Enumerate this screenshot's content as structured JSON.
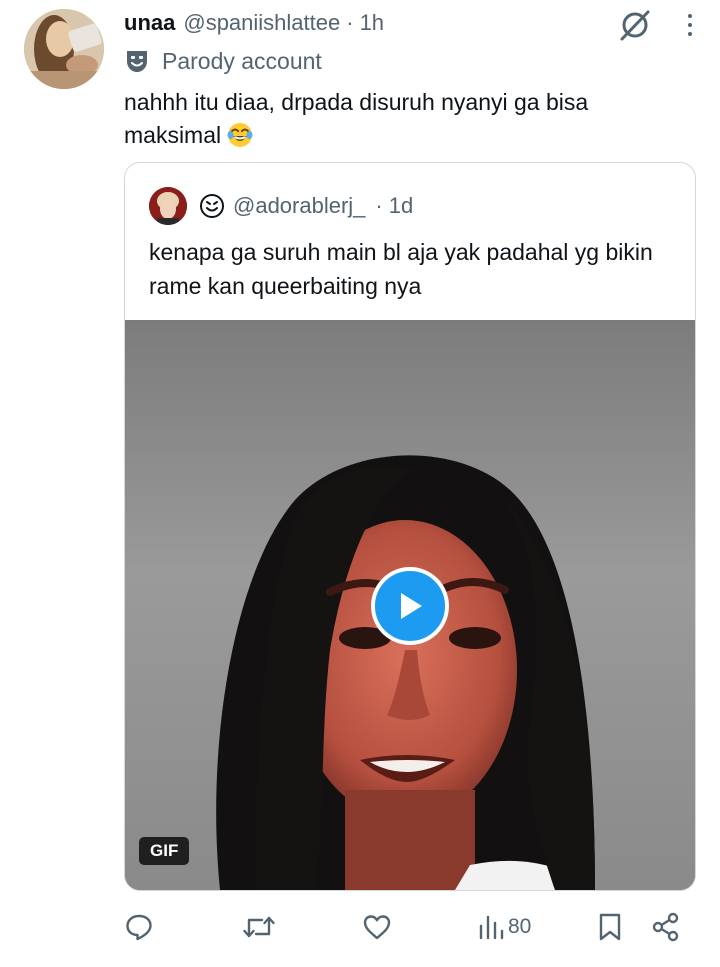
{
  "tweet": {
    "display_name": "unaa",
    "handle": "@spaniishlattee",
    "separator": "·",
    "time": "1h",
    "label": "Parody account",
    "text": "nahhh itu diaa, drpada disuruh nyanyi ga bisa maksimal",
    "emoji": "face-with-tears-of-joy"
  },
  "quoted": {
    "handle": "@adorablerj_",
    "separator": "·",
    "time": "1d",
    "text": "kenapa ga suruh main bl aja yak padahal yg bikin rame kan queerbaiting nya",
    "media": {
      "badge": "GIF"
    }
  },
  "actions": {
    "views": "80",
    "icons": [
      "reply-icon",
      "retweet-icon",
      "like-icon",
      "views-icon",
      "bookmark-icon",
      "share-icon"
    ]
  },
  "colors": {
    "text": "#0f1419",
    "secondary": "#536471",
    "accent": "#1d9bf0",
    "border": "#cfd9de"
  }
}
